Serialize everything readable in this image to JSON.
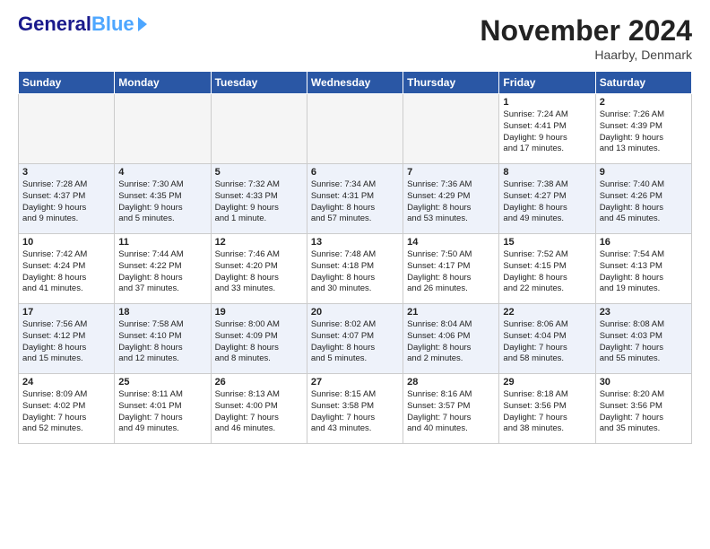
{
  "header": {
    "logo_general": "General",
    "logo_blue": "Blue",
    "month_title": "November 2024",
    "location": "Haarby, Denmark"
  },
  "weekdays": [
    "Sunday",
    "Monday",
    "Tuesday",
    "Wednesday",
    "Thursday",
    "Friday",
    "Saturday"
  ],
  "weeks": [
    [
      {
        "day": "",
        "info": ""
      },
      {
        "day": "",
        "info": ""
      },
      {
        "day": "",
        "info": ""
      },
      {
        "day": "",
        "info": ""
      },
      {
        "day": "",
        "info": ""
      },
      {
        "day": "1",
        "info": "Sunrise: 7:24 AM\nSunset: 4:41 PM\nDaylight: 9 hours\nand 17 minutes."
      },
      {
        "day": "2",
        "info": "Sunrise: 7:26 AM\nSunset: 4:39 PM\nDaylight: 9 hours\nand 13 minutes."
      }
    ],
    [
      {
        "day": "3",
        "info": "Sunrise: 7:28 AM\nSunset: 4:37 PM\nDaylight: 9 hours\nand 9 minutes."
      },
      {
        "day": "4",
        "info": "Sunrise: 7:30 AM\nSunset: 4:35 PM\nDaylight: 9 hours\nand 5 minutes."
      },
      {
        "day": "5",
        "info": "Sunrise: 7:32 AM\nSunset: 4:33 PM\nDaylight: 9 hours\nand 1 minute."
      },
      {
        "day": "6",
        "info": "Sunrise: 7:34 AM\nSunset: 4:31 PM\nDaylight: 8 hours\nand 57 minutes."
      },
      {
        "day": "7",
        "info": "Sunrise: 7:36 AM\nSunset: 4:29 PM\nDaylight: 8 hours\nand 53 minutes."
      },
      {
        "day": "8",
        "info": "Sunrise: 7:38 AM\nSunset: 4:27 PM\nDaylight: 8 hours\nand 49 minutes."
      },
      {
        "day": "9",
        "info": "Sunrise: 7:40 AM\nSunset: 4:26 PM\nDaylight: 8 hours\nand 45 minutes."
      }
    ],
    [
      {
        "day": "10",
        "info": "Sunrise: 7:42 AM\nSunset: 4:24 PM\nDaylight: 8 hours\nand 41 minutes."
      },
      {
        "day": "11",
        "info": "Sunrise: 7:44 AM\nSunset: 4:22 PM\nDaylight: 8 hours\nand 37 minutes."
      },
      {
        "day": "12",
        "info": "Sunrise: 7:46 AM\nSunset: 4:20 PM\nDaylight: 8 hours\nand 33 minutes."
      },
      {
        "day": "13",
        "info": "Sunrise: 7:48 AM\nSunset: 4:18 PM\nDaylight: 8 hours\nand 30 minutes."
      },
      {
        "day": "14",
        "info": "Sunrise: 7:50 AM\nSunset: 4:17 PM\nDaylight: 8 hours\nand 26 minutes."
      },
      {
        "day": "15",
        "info": "Sunrise: 7:52 AM\nSunset: 4:15 PM\nDaylight: 8 hours\nand 22 minutes."
      },
      {
        "day": "16",
        "info": "Sunrise: 7:54 AM\nSunset: 4:13 PM\nDaylight: 8 hours\nand 19 minutes."
      }
    ],
    [
      {
        "day": "17",
        "info": "Sunrise: 7:56 AM\nSunset: 4:12 PM\nDaylight: 8 hours\nand 15 minutes."
      },
      {
        "day": "18",
        "info": "Sunrise: 7:58 AM\nSunset: 4:10 PM\nDaylight: 8 hours\nand 12 minutes."
      },
      {
        "day": "19",
        "info": "Sunrise: 8:00 AM\nSunset: 4:09 PM\nDaylight: 8 hours\nand 8 minutes."
      },
      {
        "day": "20",
        "info": "Sunrise: 8:02 AM\nSunset: 4:07 PM\nDaylight: 8 hours\nand 5 minutes."
      },
      {
        "day": "21",
        "info": "Sunrise: 8:04 AM\nSunset: 4:06 PM\nDaylight: 8 hours\nand 2 minutes."
      },
      {
        "day": "22",
        "info": "Sunrise: 8:06 AM\nSunset: 4:04 PM\nDaylight: 7 hours\nand 58 minutes."
      },
      {
        "day": "23",
        "info": "Sunrise: 8:08 AM\nSunset: 4:03 PM\nDaylight: 7 hours\nand 55 minutes."
      }
    ],
    [
      {
        "day": "24",
        "info": "Sunrise: 8:09 AM\nSunset: 4:02 PM\nDaylight: 7 hours\nand 52 minutes."
      },
      {
        "day": "25",
        "info": "Sunrise: 8:11 AM\nSunset: 4:01 PM\nDaylight: 7 hours\nand 49 minutes."
      },
      {
        "day": "26",
        "info": "Sunrise: 8:13 AM\nSunset: 4:00 PM\nDaylight: 7 hours\nand 46 minutes."
      },
      {
        "day": "27",
        "info": "Sunrise: 8:15 AM\nSunset: 3:58 PM\nDaylight: 7 hours\nand 43 minutes."
      },
      {
        "day": "28",
        "info": "Sunrise: 8:16 AM\nSunset: 3:57 PM\nDaylight: 7 hours\nand 40 minutes."
      },
      {
        "day": "29",
        "info": "Sunrise: 8:18 AM\nSunset: 3:56 PM\nDaylight: 7 hours\nand 38 minutes."
      },
      {
        "day": "30",
        "info": "Sunrise: 8:20 AM\nSunset: 3:56 PM\nDaylight: 7 hours\nand 35 minutes."
      }
    ]
  ]
}
